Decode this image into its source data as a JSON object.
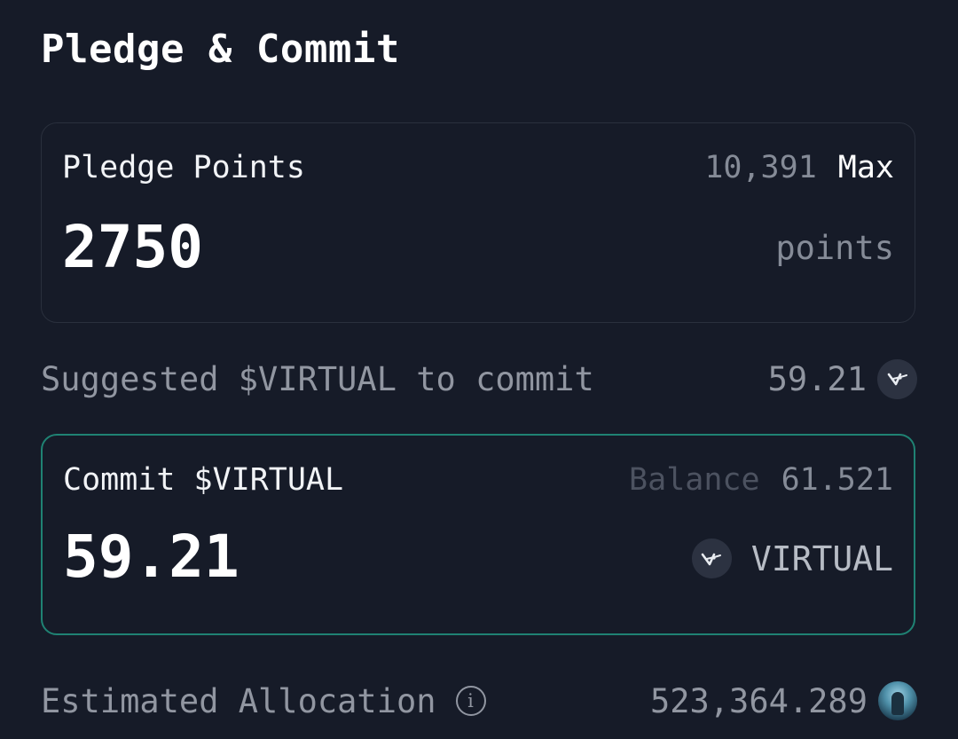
{
  "header": {
    "title": "Pledge & Commit"
  },
  "pledge": {
    "label": "Pledge Points",
    "available": "10,391",
    "max_label": "Max",
    "value": "2750",
    "unit": "points"
  },
  "suggested": {
    "label": "Suggested $VIRTUAL to commit",
    "value": "59.21",
    "icon": "virtual-token-icon"
  },
  "commit": {
    "label": "Commit $VIRTUAL",
    "balance_label": "Balance",
    "balance_value": "61.521",
    "value": "59.21",
    "unit": "VIRTUAL",
    "icon": "virtual-token-icon"
  },
  "estimated": {
    "label": "Estimated Allocation",
    "info_glyph": "i",
    "value": "523,364.289",
    "icon": "agent-avatar"
  },
  "colors": {
    "background": "#161b28",
    "commit_border": "#1f8273",
    "text_primary": "#ffffff",
    "text_muted": "#858b97"
  }
}
